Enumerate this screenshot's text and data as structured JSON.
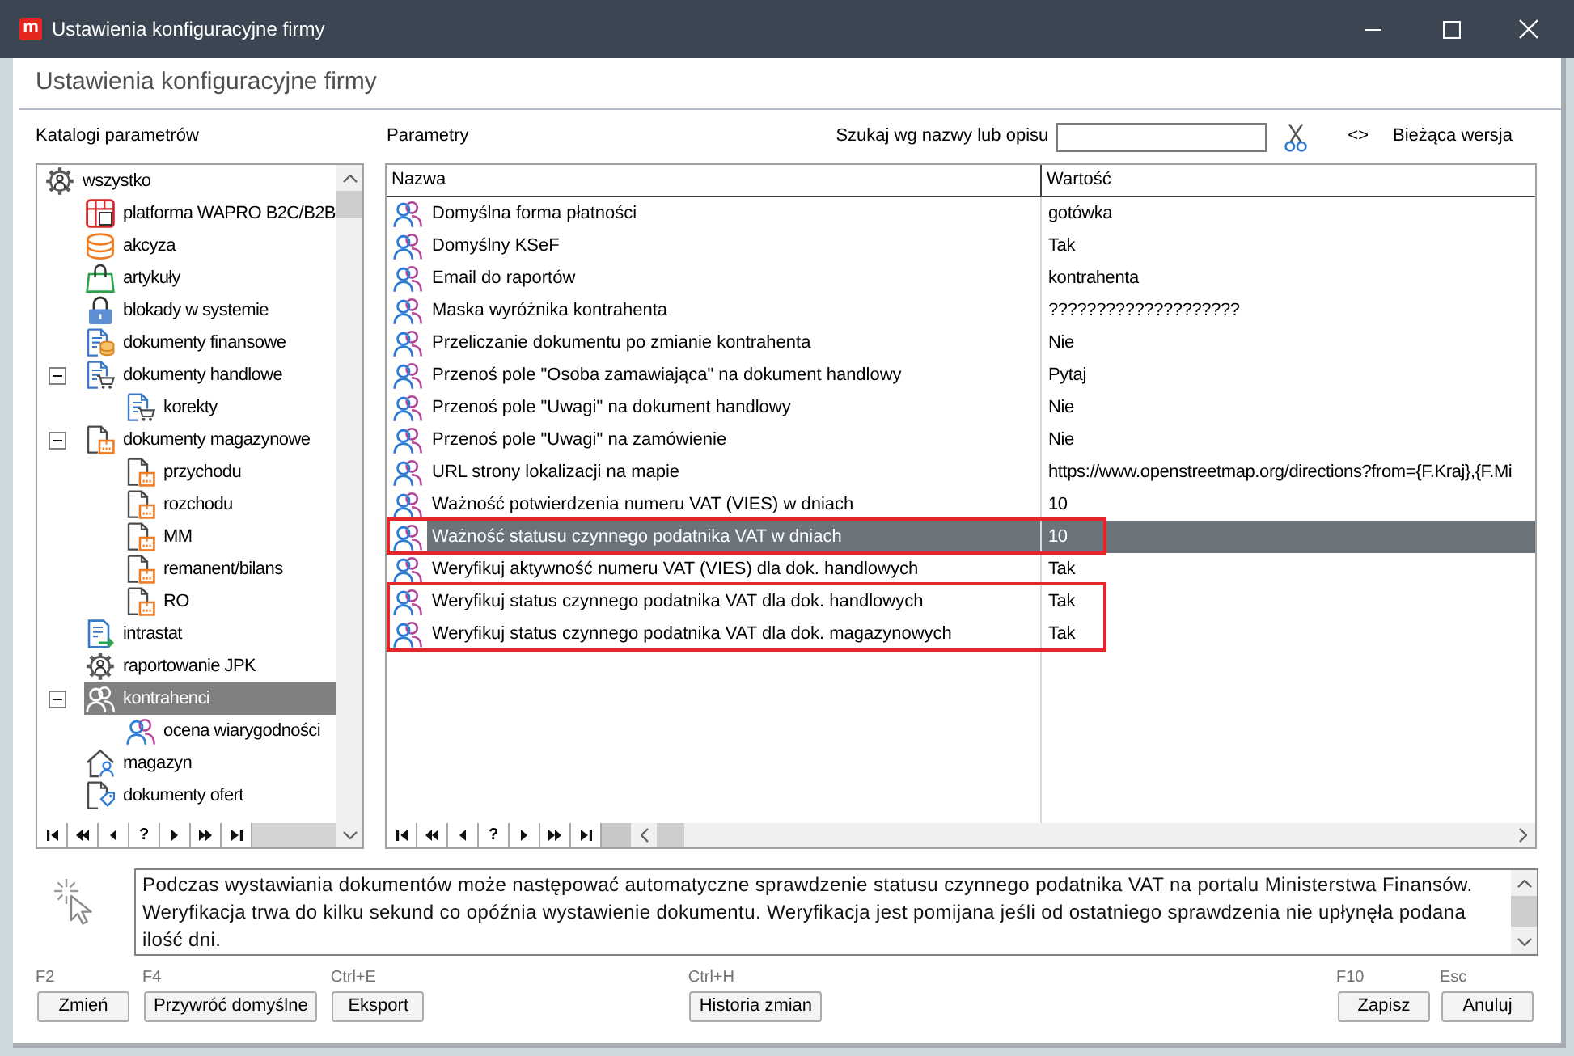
{
  "window": {
    "title": "Ustawienia konfiguracyjne firmy",
    "logo_text": "m"
  },
  "header": {
    "title": "Ustawienia konfiguracyjne firmy"
  },
  "catalog": {
    "label": "Katalogi parametrów",
    "tree": [
      {
        "label": "wszystko",
        "kind": "all",
        "selected": false,
        "children": [
          {
            "label": "platforma WAPRO B2C/B2B",
            "kind": "platform",
            "selected": false
          },
          {
            "label": "akcyza",
            "kind": "excise",
            "selected": false
          },
          {
            "label": "artykuły",
            "kind": "goods",
            "selected": false
          },
          {
            "label": "blokady w systemie",
            "kind": "locks",
            "selected": false
          },
          {
            "label": "dokumenty finansowe",
            "kind": "finance",
            "selected": false
          },
          {
            "label": "dokumenty handlowe",
            "kind": "trade",
            "selected": false,
            "expanded": true,
            "children": [
              {
                "label": "korekty",
                "kind": "trade",
                "selected": false
              }
            ]
          },
          {
            "label": "dokumenty magazynowe",
            "kind": "stock",
            "selected": false,
            "expanded": true,
            "children": [
              {
                "label": "przychodu",
                "kind": "stock",
                "selected": false
              },
              {
                "label": "rozchodu",
                "kind": "stock",
                "selected": false
              },
              {
                "label": "MM",
                "kind": "stock",
                "selected": false
              },
              {
                "label": "remanent/bilans",
                "kind": "stock",
                "selected": false
              },
              {
                "label": "RO",
                "kind": "stock",
                "selected": false
              }
            ]
          },
          {
            "label": "intrastat",
            "kind": "intrastat",
            "selected": false
          },
          {
            "label": "raportowanie JPK",
            "kind": "report",
            "selected": false
          },
          {
            "label": "kontrahenci",
            "kind": "contractor",
            "selected": true,
            "expanded": true,
            "children": [
              {
                "label": "ocena wiarygodności",
                "kind": "contractor",
                "selected": false
              }
            ]
          },
          {
            "label": "magazyn",
            "kind": "store",
            "selected": false
          },
          {
            "label": "dokumenty ofert",
            "kind": "offer",
            "selected": false
          }
        ]
      }
    ],
    "navigator": [
      {
        "kind": "first"
      },
      {
        "kind": "prior_page"
      },
      {
        "kind": "prior"
      },
      {
        "kind": "help",
        "text": "?"
      },
      {
        "kind": "next"
      },
      {
        "kind": "next_page"
      },
      {
        "kind": "last"
      }
    ]
  },
  "parameters": {
    "label": "Parametry",
    "search": {
      "label": "Szukaj wg nazwy lub opisu"
    },
    "version_switch": {
      "symbol": "<>",
      "label": "Bieżąca wersja"
    },
    "table": {
      "columns": [
        "Nazwa",
        "Wartość"
      ],
      "rows": [
        {
          "name": "Domyślna forma płatności",
          "value": "gotówka",
          "selected": false,
          "marked": false
        },
        {
          "name": "Domyślny KSeF",
          "value": "Tak",
          "selected": false,
          "marked": false
        },
        {
          "name": "Email do raportów",
          "value": "kontrahenta",
          "selected": false,
          "marked": false
        },
        {
          "name": "Maska wyróżnika kontrahenta",
          "value": "????????????????????",
          "selected": false,
          "marked": false
        },
        {
          "name": "Przeliczanie dokumentu po zmianie kontrahenta",
          "value": "Nie",
          "selected": false,
          "marked": false
        },
        {
          "name": "Przenoś pole \"Osoba zamawiająca\" na dokument handlowy",
          "value": "Pytaj",
          "selected": false,
          "marked": false
        },
        {
          "name": "Przenoś pole \"Uwagi\" na dokument handlowy",
          "value": "Nie",
          "selected": false,
          "marked": false
        },
        {
          "name": "Przenoś pole \"Uwagi\" na zamówienie",
          "value": "Nie",
          "selected": false,
          "marked": false
        },
        {
          "name": "URL strony lokalizacji na mapie",
          "value": "https://www.openstreetmap.org/directions?from={F.Kraj},{F.Mi",
          "selected": false,
          "marked": false
        },
        {
          "name": "Ważność potwierdzenia numeru VAT (VIES) w dniach",
          "value": "10",
          "selected": false,
          "marked": false
        },
        {
          "name": "Ważność statusu czynnego podatnika VAT w dniach",
          "value": "10",
          "selected": true,
          "marked": true
        },
        {
          "name": "Weryfikuj aktywność numeru VAT (VIES) dla dok. handlowych",
          "value": "Tak",
          "selected": false,
          "marked": false
        },
        {
          "name": "Weryfikuj status czynnego podatnika VAT dla dok. handlowych",
          "value": "Tak",
          "selected": false,
          "marked": true
        },
        {
          "name": "Weryfikuj status czynnego podatnika VAT dla dok. magazynowych",
          "value": "Tak",
          "selected": false,
          "marked": true
        }
      ],
      "navigator": [
        {
          "kind": "first"
        },
        {
          "kind": "prior_page"
        },
        {
          "kind": "prior"
        },
        {
          "kind": "help",
          "text": "?"
        },
        {
          "kind": "next"
        },
        {
          "kind": "next_page"
        },
        {
          "kind": "last"
        }
      ]
    }
  },
  "description": {
    "text": "Podczas wystawiania dokumentów może następować automatyczne sprawdzenie statusu czynnego podatnika VAT na portalu Ministerstwa Finansów. Weryfikacja trwa do kilku sekund co opóźnia wystawienie dokumentu. Weryfikacja jest pomijana jeśli od ostatniego sprawdzenia nie upłynęła podana ilość dni."
  },
  "buttons": {
    "left": [
      {
        "shortcut": "F2",
        "label": "Zmień"
      },
      {
        "shortcut": "F4",
        "label": "Przywróć domyślne"
      },
      {
        "shortcut": "Ctrl+E",
        "label": "Eksport"
      }
    ],
    "middle": [
      {
        "shortcut": "Ctrl+H",
        "label": "Historia zmian"
      }
    ],
    "right": [
      {
        "shortcut": "F10",
        "label": "Zapisz"
      },
      {
        "shortcut": "Esc",
        "label": "Anuluj"
      }
    ]
  }
}
